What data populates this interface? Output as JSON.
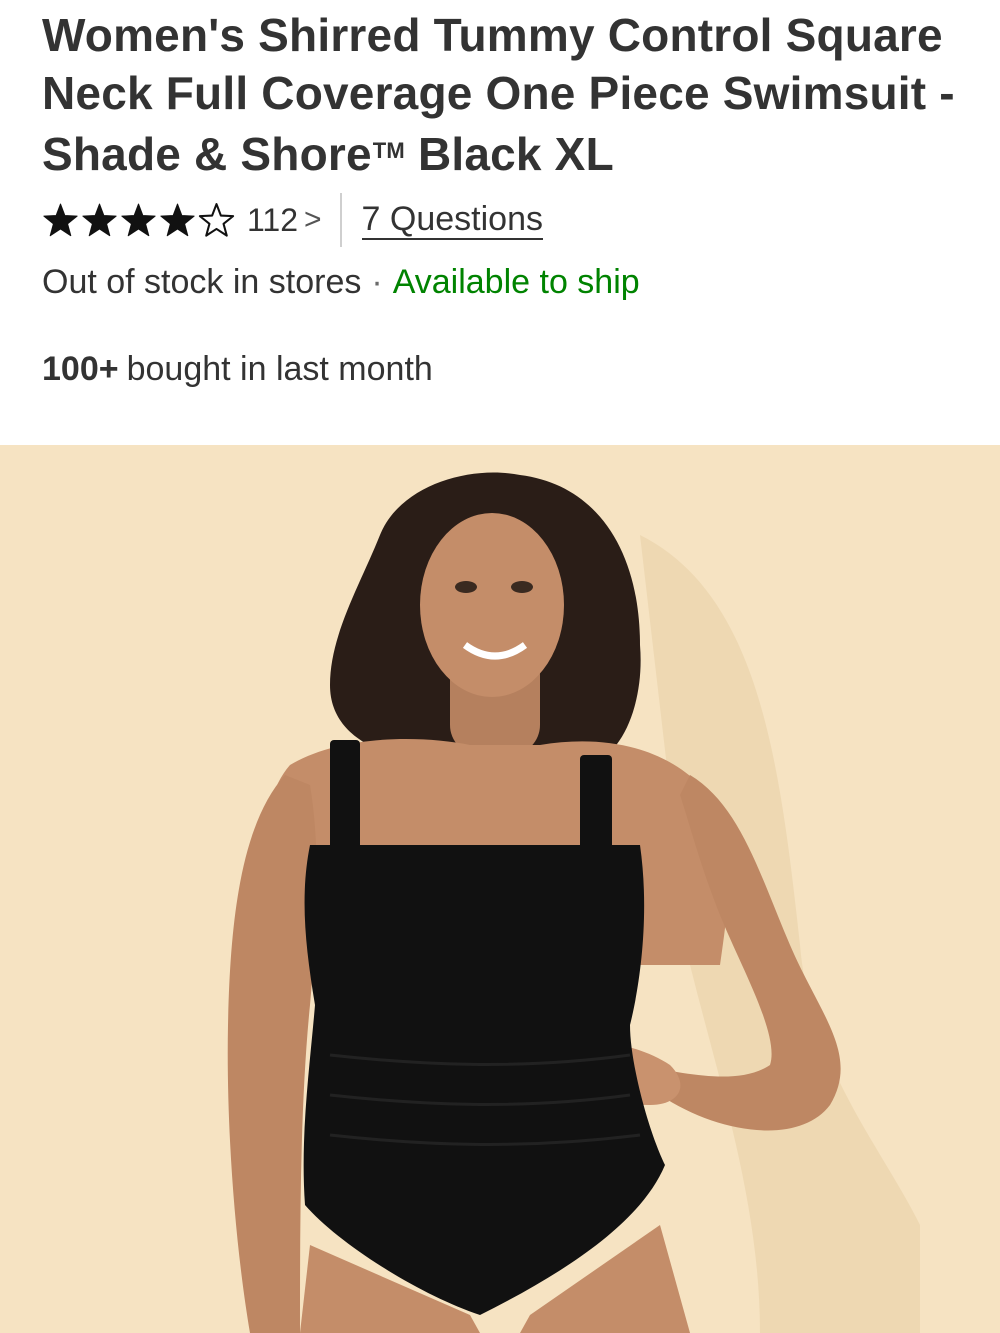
{
  "product": {
    "title_main": "Women's Shirred Tummy Control Square Neck Full Coverage One Piece Swimsuit - Shade & Shore",
    "trademark": "TM",
    "title_suffix": "Black XL",
    "rating": {
      "value": 4,
      "max": 5,
      "review_count": "112",
      "chevron": ">",
      "star_icon": "star-icon"
    },
    "questions_link": "7 Questions",
    "availability": {
      "out_of_stock": "Out of stock in stores",
      "separator": "·",
      "available": "Available to ship",
      "available_color": "#008300"
    },
    "purchases": {
      "count": "100+",
      "text": "bought in last month"
    },
    "image": {
      "background_color": "#f6e3c2",
      "swimsuit_color": "#111111"
    }
  }
}
